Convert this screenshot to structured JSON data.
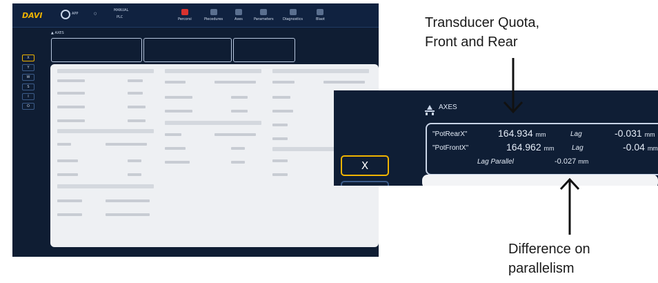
{
  "app": {
    "brand": "DAVI",
    "user_label": "APP",
    "mode_label_1": "MANUAL",
    "mode_label_2": "PLC",
    "nav": [
      {
        "label": "Percorsi",
        "icon": "path-icon",
        "active": true
      },
      {
        "label": "Piecedures",
        "icon": "layers-icon",
        "active": false
      },
      {
        "label": "Axes",
        "icon": "axes-icon",
        "active": false
      },
      {
        "label": "Parameters",
        "icon": "sliders-icon",
        "active": false
      },
      {
        "label": "Diagnostics",
        "icon": "chart-icon",
        "active": false
      },
      {
        "label": "Blaot",
        "icon": "chat-icon",
        "active": false
      }
    ],
    "left_tabs": [
      "X",
      "Y",
      "W",
      "S",
      "I",
      "O"
    ],
    "axes_title": "AXES"
  },
  "zoom": {
    "title": "AXES",
    "rows": [
      {
        "name": "\"PotRearX\"",
        "value": "164.934",
        "unit": "mm",
        "lag_label": "Lag",
        "lag_value": "-0.031",
        "lag_unit": "mm"
      },
      {
        "name": "\"PotFrontX\"",
        "value": "164.962",
        "unit": "mm",
        "lag_label": "Lag",
        "lag_value": "-0.04",
        "lag_unit": "mm"
      }
    ],
    "parallel_label": "Lag Parallel",
    "parallel_value": "-0.027",
    "parallel_unit": "mm",
    "close_button": "X"
  },
  "callouts": {
    "top_line1": "Transducer Quota,",
    "top_line2": "Front and Rear",
    "bottom_line1": "Difference on",
    "bottom_line2": "parallelism"
  },
  "colors": {
    "background": "#0f1d33",
    "accent": "#f0b400",
    "active_nav": "#d9322f",
    "panel": "#eef0f3"
  }
}
